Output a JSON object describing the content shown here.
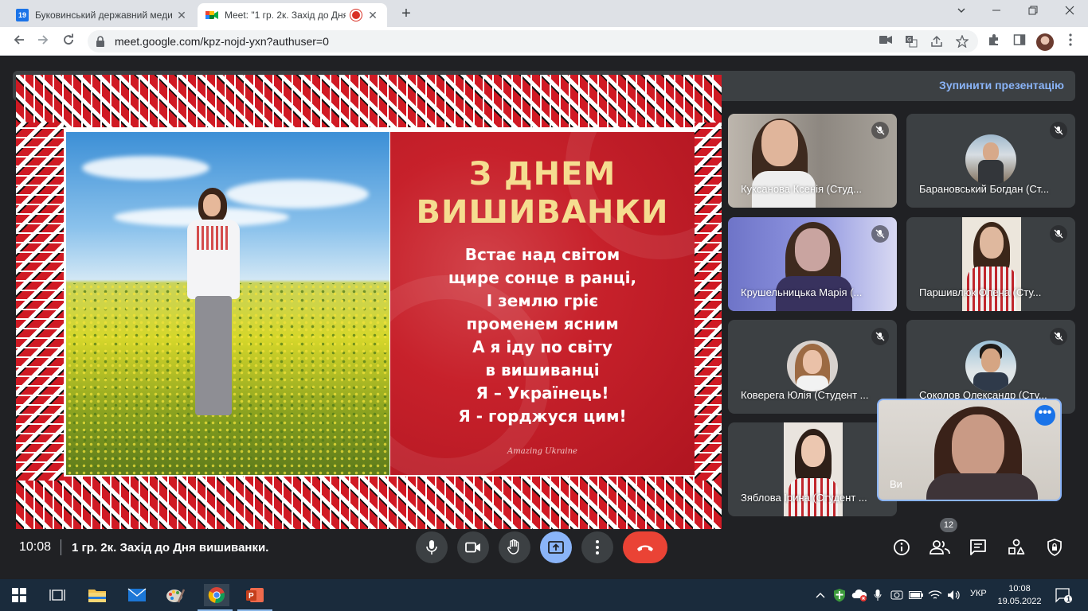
{
  "browser": {
    "tabs": [
      {
        "favicon_text": "19",
        "title": "Буковинський державний меди"
      },
      {
        "title": "Meet: \"1 гр. 2к. Захід до Дня"
      }
    ],
    "url": "meet.google.com/kpz-nojd-yxn?authuser=0",
    "close_glyph": "✕",
    "newtab_glyph": "+"
  },
  "meet": {
    "stop_presenting": "Зупинити презентацію",
    "slide": {
      "title_line1": "З ДНЕМ",
      "title_line2": "ВИШИВАНКИ",
      "poem": [
        "Встає над світом",
        "щире сонце в ранці,",
        "І землю гріє",
        "променем ясним",
        "А я іду по світу",
        "в вишиванці",
        "Я – Українець!",
        "Я - горджуся цим!"
      ],
      "signature": "Amazing Ukraine"
    },
    "participants": [
      {
        "name": "Куксанова Ксенія (Студ..."
      },
      {
        "name": "Барановський Богдан (Ст..."
      },
      {
        "name": "Крушельницька Марія (..."
      },
      {
        "name": "Паршивлюк Олена (Сту..."
      },
      {
        "name": "Коверега Юлія (Студент ..."
      },
      {
        "name": "Соколов Олександр (Сту..."
      },
      {
        "name": "Зяблова Ірина (Студент ..."
      }
    ],
    "self_name": "Ви",
    "self_more": "•••",
    "time": "10:08",
    "meeting_title": "1 гр. 2к. Захід до Дня вишиванки.",
    "people_count": "12"
  },
  "taskbar": {
    "lang": "УКР",
    "time": "10:08",
    "date": "19.05.2022",
    "notifications": "1"
  },
  "colors": {
    "meet_bg": "#202124",
    "accent_blue": "#8ab4f8",
    "hangup_red": "#ea4335",
    "slide_red": "#c7212b",
    "slide_gold": "#f5dd90"
  }
}
